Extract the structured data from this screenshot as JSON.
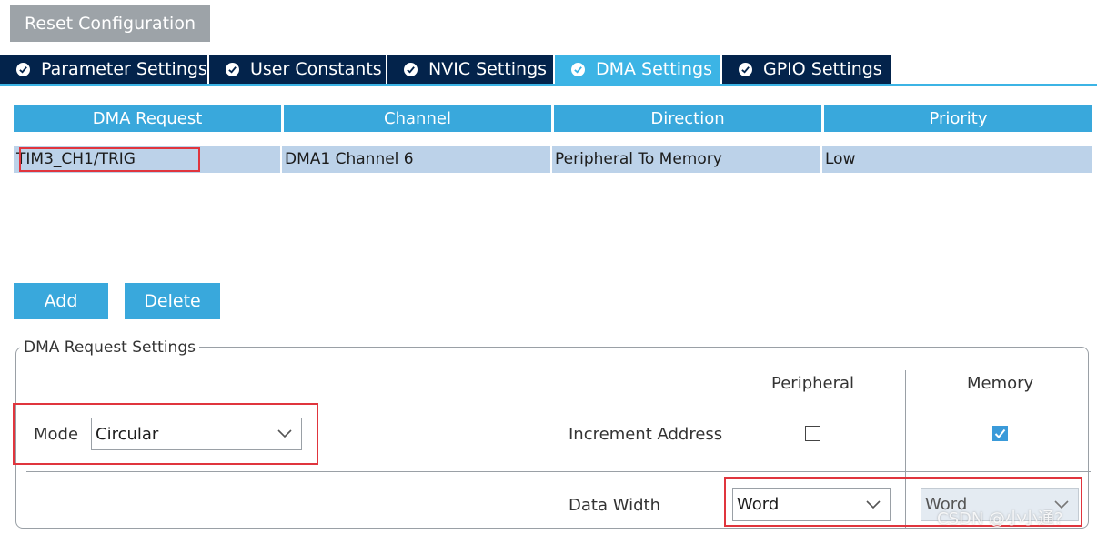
{
  "toolbar": {
    "reset_label": "Reset Configuration"
  },
  "tabs": [
    {
      "label": "Parameter Settings",
      "active": false
    },
    {
      "label": "User Constants",
      "active": false
    },
    {
      "label": "NVIC Settings",
      "active": false
    },
    {
      "label": "DMA Settings",
      "active": true
    },
    {
      "label": "GPIO Settings",
      "active": false
    }
  ],
  "table": {
    "headers": [
      "DMA Request",
      "Channel",
      "Direction",
      "Priority"
    ],
    "rows": [
      [
        "TIM3_CH1/TRIG",
        "DMA1 Channel 6",
        "Peripheral To Memory",
        "Low"
      ]
    ]
  },
  "actions": {
    "add_label": "Add",
    "delete_label": "Delete"
  },
  "settings": {
    "group_title": "DMA Request Settings",
    "mode_label": "Mode",
    "mode_value": "Circular",
    "peripheral_header": "Peripheral",
    "memory_header": "Memory",
    "increment_label": "Increment Address",
    "peripheral_increment": false,
    "memory_increment": true,
    "data_width_label": "Data Width",
    "peripheral_width": "Word",
    "memory_width": "Word"
  },
  "watermark": "CSDN @小小通?",
  "colors": {
    "tab_dark": "#03234b",
    "accent": "#39a8dc",
    "highlight": "#e0353d",
    "row_selected": "#bcd2e9"
  }
}
